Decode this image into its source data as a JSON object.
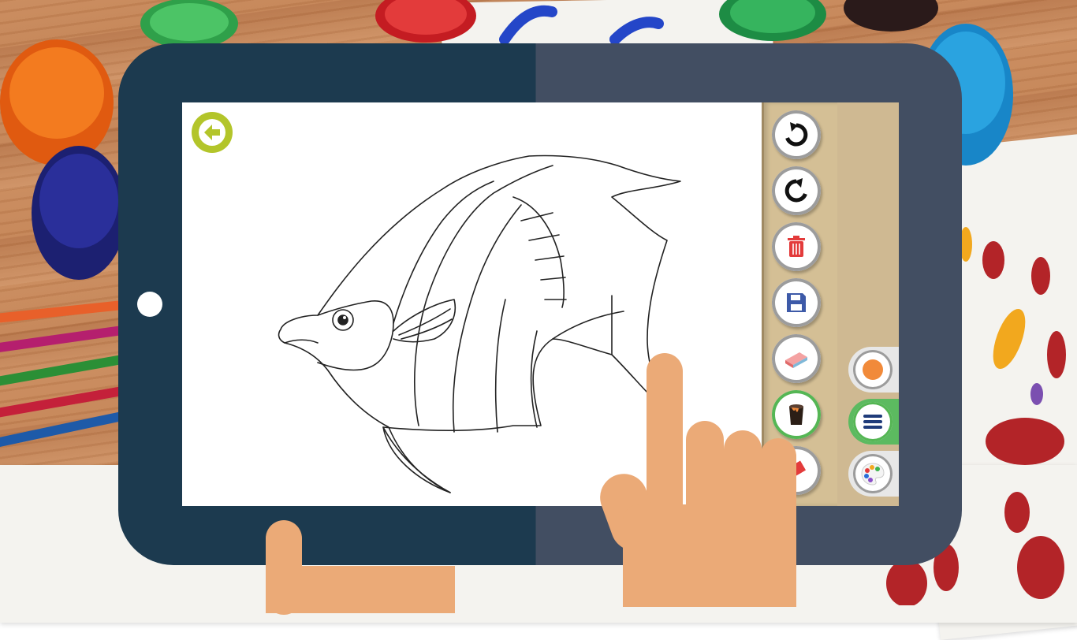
{
  "app": {
    "colors": {
      "tablet_left": "#1c3a4f",
      "tablet_right": "#424e62",
      "tool_panel": "#d4bf95",
      "back_button": "#b3c52a",
      "active_tool_ring": "#55b654",
      "selected_color": "#f18a3a"
    }
  },
  "toolbar": {
    "tools": [
      {
        "name": "undo",
        "icon": "undo-icon"
      },
      {
        "name": "redo",
        "icon": "redo-icon"
      },
      {
        "name": "delete",
        "icon": "trash-icon"
      },
      {
        "name": "save",
        "icon": "floppy-disk-icon"
      },
      {
        "name": "eraser",
        "icon": "eraser-icon"
      },
      {
        "name": "paint-bucket",
        "icon": "paint-bucket-icon",
        "active": true
      },
      {
        "name": "crayon",
        "icon": "crayon-icon"
      }
    ],
    "side_tabs": [
      {
        "name": "current-color",
        "icon": "color-dot-icon"
      },
      {
        "name": "menu",
        "icon": "hamburger-menu-icon",
        "active": true
      },
      {
        "name": "palette",
        "icon": "palette-icon"
      }
    ]
  },
  "canvas": {
    "drawing": "angelfish-outline",
    "back_icon": "arrow-left-icon"
  }
}
